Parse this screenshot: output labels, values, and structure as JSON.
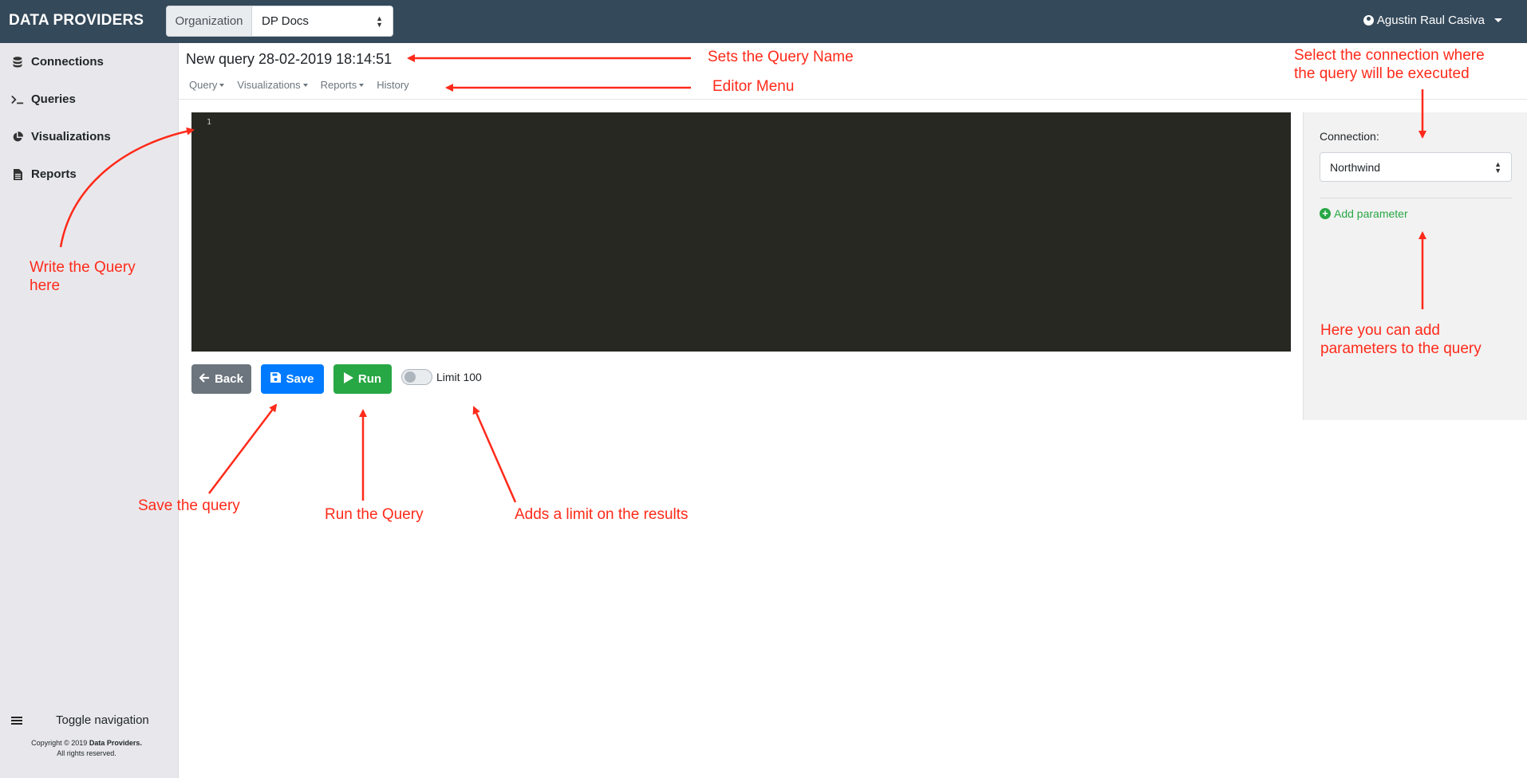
{
  "header": {
    "brand": "DATA PROVIDERS",
    "organization_label": "Organization",
    "organization_value": "DP Docs",
    "user_name": "Agustin Raul Casiva"
  },
  "sidebar": {
    "items": [
      {
        "label": "Connections",
        "icon": "database-icon"
      },
      {
        "label": "Queries",
        "icon": "terminal-icon"
      },
      {
        "label": "Visualizations",
        "icon": "pie-chart-icon"
      },
      {
        "label": "Reports",
        "icon": "file-icon"
      }
    ],
    "toggle_label": "Toggle navigation",
    "copyright_line1_prefix": "Copyright © 2019 ",
    "copyright_line1_bold": "Data Providers.",
    "copyright_line2": "All rights reserved."
  },
  "editor": {
    "title": "New query 28-02-2019 18:14:51",
    "menu": [
      "Query",
      "Visualizations",
      "Reports",
      "History"
    ],
    "line_number": "1"
  },
  "actions": {
    "back_label": "Back",
    "save_label": "Save",
    "run_label": "Run",
    "limit_label": "Limit 100"
  },
  "panel": {
    "connection_label": "Connection:",
    "connection_value": "Northwind",
    "add_parameter_label": "Add parameter"
  },
  "annotations": {
    "query_name": "Sets the Query Name",
    "editor_menu": "Editor Menu",
    "connection_line1": "Select the connection where",
    "connection_line2": "the query will be executed",
    "write_query_line1": "Write the Query",
    "write_query_line2": "here",
    "parameters_line1": "Here you can add",
    "parameters_line2": "parameters to the query",
    "save": "Save the query",
    "run": "Run the Query",
    "limit": "Adds a limit on the results"
  },
  "colors": {
    "topbar": "#34495a",
    "annotation": "#ff2a1a",
    "primary": "#007bff",
    "success": "#28a745",
    "secondary": "#6c757d",
    "editor_bg": "#272822"
  }
}
